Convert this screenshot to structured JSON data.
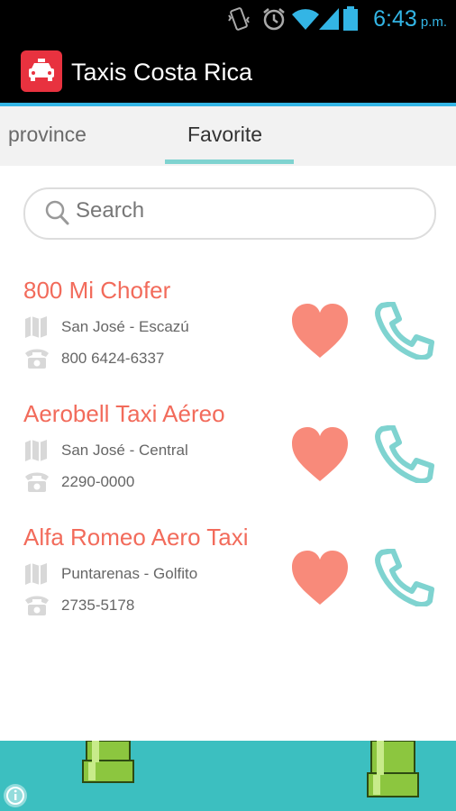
{
  "status": {
    "time": "6:43",
    "ampm": "p.m."
  },
  "app": {
    "title": "Taxis Costa Rica",
    "icon": "taxi-icon",
    "brand_color": "#e8323f"
  },
  "tabs": [
    {
      "label": "province",
      "selected": false
    },
    {
      "label": "Favorite",
      "selected": true
    }
  ],
  "search": {
    "placeholder": "Search",
    "value": ""
  },
  "favorites": [
    {
      "name": "800 Mi Chofer",
      "location": "San José - Escazú",
      "phone": "800 6424-6337",
      "favorite": true
    },
    {
      "name": "Aerobell Taxi Aéreo",
      "location": "San José - Central",
      "phone": "2290-0000",
      "favorite": true
    },
    {
      "name": "Alfa Romeo Aero Taxi",
      "location": "Puntarenas - Golfito",
      "phone": "2735-5178",
      "favorite": true
    }
  ],
  "colors": {
    "accent": "#33b5e5",
    "name": "#f26b5b",
    "heart": "#f88a7a",
    "phone": "#7fd3d0",
    "ad_bg": "#3cbfc0"
  }
}
